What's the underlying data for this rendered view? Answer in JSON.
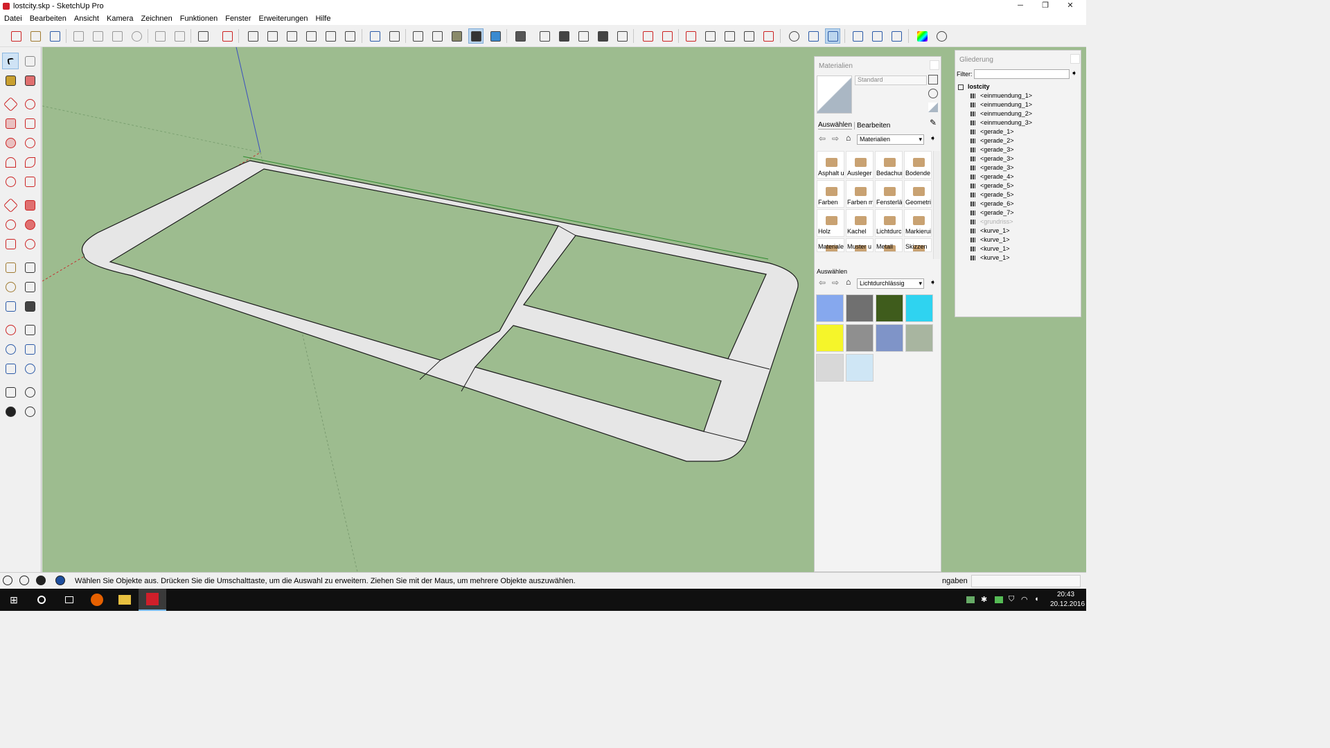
{
  "window": {
    "title": "lostcity.skp - SketchUp Pro",
    "minimize": "─",
    "restore": "❐",
    "close": "✕"
  },
  "menu": [
    "Datei",
    "Bearbeiten",
    "Ansicht",
    "Kamera",
    "Zeichnen",
    "Funktionen",
    "Fenster",
    "Erweiterungen",
    "Hilfe"
  ],
  "materials": {
    "title": "Materialien",
    "name_value": "Standard",
    "tab_select": "Auswählen",
    "tab_edit": "Bearbeiten",
    "collection": "Materialien",
    "folders": [
      "Asphalt u",
      "Ausleger",
      "Bedachur",
      "Bodende",
      "Farben",
      "Farben m",
      "Fensterlä",
      "Geometri",
      "Holz",
      "Kachel",
      "Lichtdurc",
      "Markierui",
      "Materiale",
      "Muster u",
      "Metall",
      "Skizzen"
    ],
    "secondary_label": "Auswählen",
    "secondary_collection": "Lichtdurchlässig",
    "swatch_colors": [
      "#86a8ee",
      "#707070",
      "#3f5c1c",
      "#2fd3f0",
      "#f5f52a",
      "#8f8f8f",
      "#7f94c8",
      "#a8b5a0",
      "#d8d8d8",
      "#cfe6f5"
    ]
  },
  "outliner": {
    "title": "Gliederung",
    "filter_label": "Filter:",
    "root": "lostcity",
    "items": [
      "<einmuendung_1>",
      "<einmuendung_1>",
      "<einmuendung_2>",
      "<einmuendung_3>",
      "<gerade_1>",
      "<gerade_2>",
      "<gerade_3>",
      "<gerade_3>",
      "<gerade_3>",
      "<gerade_4>",
      "<gerade_5>",
      "<gerade_5>",
      "<gerade_6>",
      "<gerade_7>",
      "<grundriss>",
      "<kurve_1>",
      "<kurve_1>",
      "<kurve_1>",
      "<kurve_1>"
    ]
  },
  "status": {
    "message": "Wählen Sie Objekte aus. Drücken Sie die Umschalttaste, um die Auswahl zu erweitern. Ziehen Sie mit der Maus, um mehrere Objekte auszuwählen.",
    "measurements": "ngaben"
  },
  "taskbar": {
    "time": "20:43",
    "date": "20.12.2016"
  },
  "colors": {
    "viewport": "#9dbc8f",
    "road": "#e6e6e6",
    "edge": "#1a1a1a",
    "axis_blue": "#3a4fc0",
    "axis_red": "#c43030",
    "axis_green": "#2e8a2e"
  },
  "icons": {
    "close": "close-icon",
    "pin": "pin-icon",
    "eyedropper": "eyedropper-icon",
    "home": "home-icon"
  }
}
